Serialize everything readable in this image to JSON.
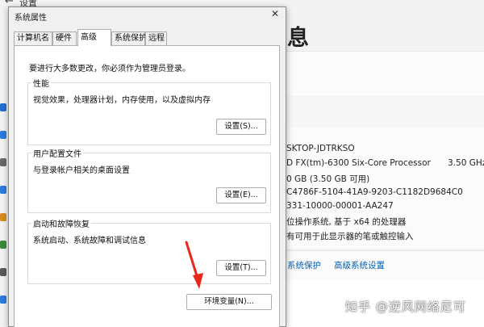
{
  "background": {
    "window_title": "设置",
    "heading": "息",
    "specs": {
      "device_name": "SKTOP-JDTRKSO",
      "processor": "D FX(tm)-6300 Six-Core Processor",
      "processor_speed": "3.50 GHz",
      "ram": "0 GB (3.50 GB 可用)",
      "device_id": "C4786F-5104-41A9-9203-C1182D9684C0",
      "product_id": "331-10000-00001-AA247",
      "system_type": "位操作系统, 基于 x64 的处理器",
      "pen_touch": "有可用于此显示器的笔或触控输入"
    },
    "links": {
      "system_protection": "系统保护",
      "advanced_settings": "高级系统设置"
    },
    "watermark": "知乎 @逆风网络尼可"
  },
  "dialog": {
    "title": "系统属性",
    "tabs": [
      "计算机名",
      "硬件",
      "高级",
      "系统保护",
      "远程"
    ],
    "active_tab": "高级",
    "notice": "要进行大多数更改，你必须作为管理员登录。",
    "performance": {
      "label": "性能",
      "description": "视觉效果，处理器计划，内存使用，以及虚拟内存",
      "button": "设置(S)..."
    },
    "user_profiles": {
      "label": "用户配置文件",
      "description": "与登录帐户相关的桌面设置",
      "button": "设置(E)..."
    },
    "startup_recovery": {
      "label": "启动和故障恢复",
      "description": "系统启动、系统故障和调试信息",
      "button": "设置(T)..."
    },
    "env_button": "环境变量(N)..."
  },
  "colors": {
    "link": "#005fb8",
    "annotation_arrow": "#e8271b"
  }
}
